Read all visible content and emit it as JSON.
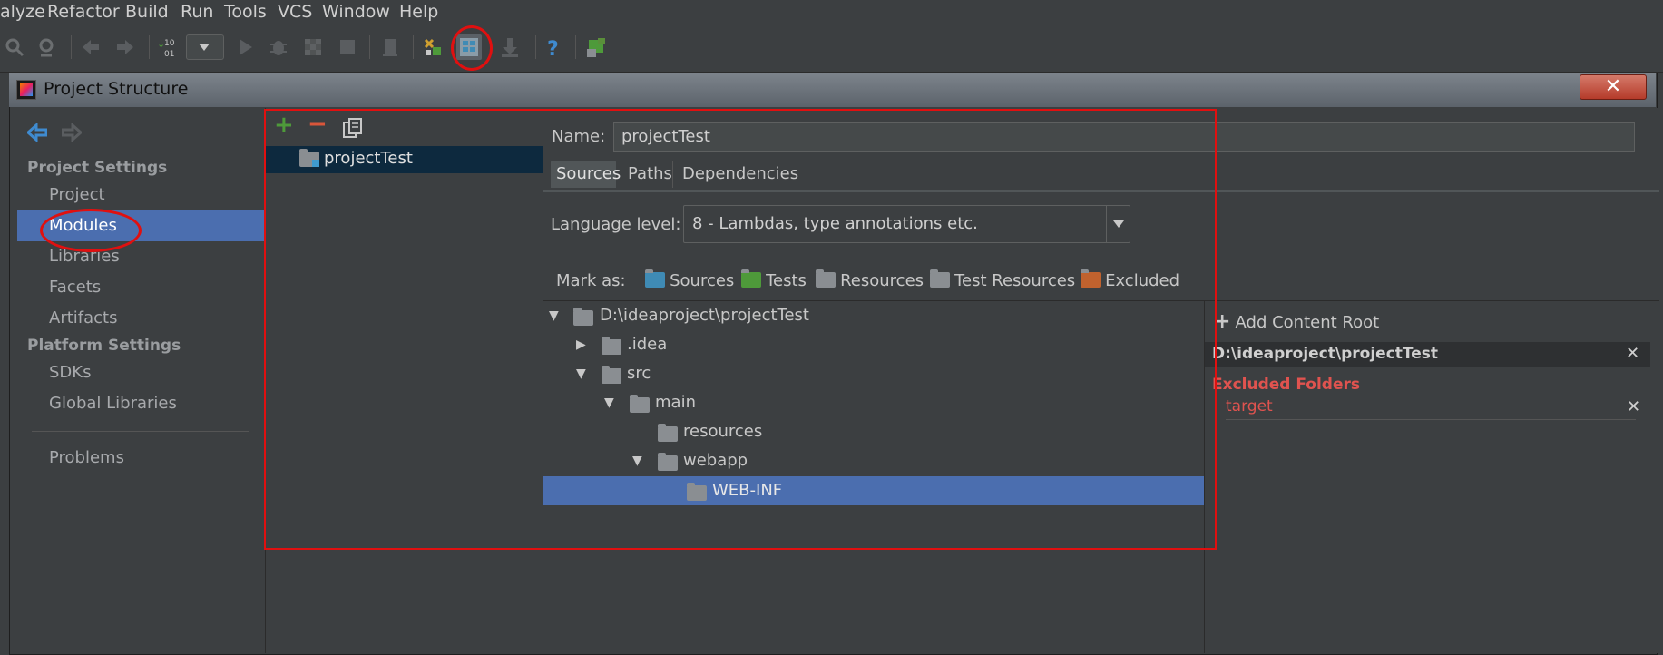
{
  "menu": [
    "alyze",
    "Refactor",
    "Build",
    "Run",
    "Tools",
    "VCS",
    "Window",
    "Help"
  ],
  "dialog": {
    "title": "Project Structure",
    "close": "✕"
  },
  "sidebar": {
    "project_settings_header": "Project Settings",
    "project_items": [
      "Project",
      "Modules",
      "Libraries",
      "Facets",
      "Artifacts"
    ],
    "platform_settings_header": "Platform Settings",
    "platform_items": [
      "SDKs",
      "Global Libraries"
    ],
    "problems": "Problems",
    "selected": "Modules"
  },
  "modules": {
    "add": "+",
    "remove": "−",
    "items": [
      "projectTest"
    ]
  },
  "module": {
    "name_label": "Name:",
    "name_value": "projectTest",
    "tabs": [
      "Sources",
      "Paths",
      "Dependencies"
    ],
    "active_tab": "Sources",
    "language_level_label": "Language level:",
    "language_level_value": "8 - Lambdas, type annotations etc.",
    "mark_as_label": "Mark as:",
    "mark_as": [
      {
        "label": "Sources",
        "color": "#3f8bb5"
      },
      {
        "label": "Tests",
        "color": "#4e9a3a"
      },
      {
        "label": "Resources",
        "color": "#8a8e92"
      },
      {
        "label": "Test Resources",
        "color": "#8a8e92"
      },
      {
        "label": "Excluded",
        "color": "#c0622e"
      }
    ]
  },
  "tree": {
    "root": "D:\\ideaproject\\projectTest",
    "idea": ".idea",
    "src": "src",
    "main": "main",
    "resources": "resources",
    "webapp": "webapp",
    "webinf": "WEB-INF"
  },
  "content_root": {
    "add_label": "Add Content Root",
    "path": "D:\\ideaproject\\projectTest",
    "excluded_header": "Excluded Folders",
    "excluded_items": [
      "target"
    ]
  },
  "colors": {
    "selection": "#4b6eaf",
    "excluded_red": "#e0534f",
    "annotation_red": "#e01010"
  }
}
